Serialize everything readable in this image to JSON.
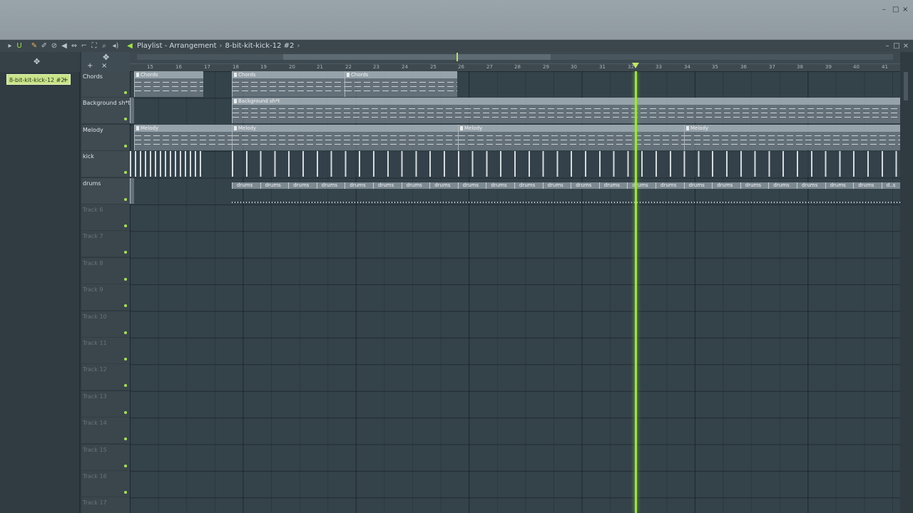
{
  "window": {
    "min": "–",
    "max": "□",
    "close": "×"
  },
  "playlist": {
    "breadcrumb": [
      "Playlist - Arrangement",
      "8-bit-kit-kick-12 #2"
    ],
    "breadcrumb_arrow": "›",
    "title_min": "–",
    "title_max": "□",
    "title_close": "×",
    "tools": [
      "▸",
      "U",
      "✎",
      "✐",
      "⊘",
      "◀",
      "⇔",
      "⌐",
      "⛶",
      "⌕",
      "◂)"
    ]
  },
  "picker": {
    "selected_pattern": "8-bit-kit-kick-12 #2",
    "add_label": "+"
  },
  "tracks_header": {
    "add": "+",
    "remove": "×"
  },
  "tracks": [
    {
      "label": "Chords",
      "named": true
    },
    {
      "label": "Background sh*t",
      "named": true
    },
    {
      "label": "Melody",
      "named": true
    },
    {
      "label": "kick",
      "named": true
    },
    {
      "label": "drums",
      "named": true
    },
    {
      "label": "Track 6",
      "named": false
    },
    {
      "label": "Track 7",
      "named": false
    },
    {
      "label": "Track 8",
      "named": false
    },
    {
      "label": "Track 9",
      "named": false
    },
    {
      "label": "Track 10",
      "named": false
    },
    {
      "label": "Track 11",
      "named": false
    },
    {
      "label": "Track 12",
      "named": false
    },
    {
      "label": "Track 13",
      "named": false
    },
    {
      "label": "Track 14",
      "named": false
    },
    {
      "label": "Track 15",
      "named": false
    },
    {
      "label": "Track 16",
      "named": false
    },
    {
      "label": "Track 17",
      "named": false
    }
  ],
  "ruler": {
    "bars": [
      "15",
      "16",
      "17",
      "18",
      "19",
      "20",
      "21",
      "22",
      "23",
      "24",
      "25",
      "26",
      "27",
      "28",
      "29",
      "30",
      "31",
      "32",
      "33",
      "34",
      "35",
      "36",
      "37",
      "38",
      "39",
      "40",
      "41"
    ]
  },
  "clips": {
    "chords": [
      "Chords",
      "Chords",
      "Chords"
    ],
    "background": [
      "Background sh*t"
    ],
    "melody": [
      "Melody",
      "Melody",
      "Melody",
      "Melody"
    ],
    "drums_label": "drums",
    "drums_last": "d..s"
  },
  "colors": {
    "accent": "#9ee04a",
    "pattern_chip": "#c9e38a",
    "grid": "#34424a"
  }
}
